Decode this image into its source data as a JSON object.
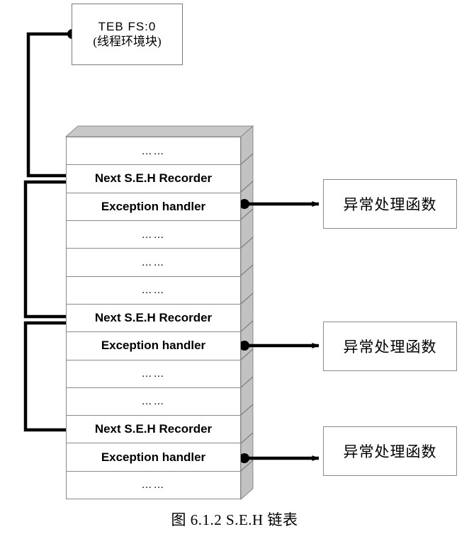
{
  "figure": {
    "caption": "图 6.1.2    S.E.H 链表"
  },
  "teb": {
    "line1": "TEB  FS:0",
    "line2": "(线程环境块)"
  },
  "stack": {
    "rows": [
      {
        "type": "dots",
        "label": "……"
      },
      {
        "type": "next",
        "label": "Next S.E.H Recorder"
      },
      {
        "type": "handler",
        "label": "Exception handler"
      },
      {
        "type": "dots",
        "label": "……"
      },
      {
        "type": "dots",
        "label": "……"
      },
      {
        "type": "dots",
        "label": "……"
      },
      {
        "type": "next",
        "label": "Next S.E.H Recorder"
      },
      {
        "type": "handler",
        "label": "Exception handler"
      },
      {
        "type": "dots",
        "label": "……"
      },
      {
        "type": "dots",
        "label": "……"
      },
      {
        "type": "next",
        "label": "Next S.E.H Recorder"
      },
      {
        "type": "handler",
        "label": "Exception handler"
      },
      {
        "type": "dots",
        "label": "……"
      }
    ]
  },
  "handlers": [
    {
      "label": "异常处理函数"
    },
    {
      "label": "异常处理函数"
    },
    {
      "label": "异常处理函数"
    }
  ],
  "colors": {
    "line": "#000000",
    "box_border": "#8a8a8a",
    "stack_side": "#c2c2c2",
    "stack_top": "#c8c8c8",
    "background": "#ffffff"
  }
}
